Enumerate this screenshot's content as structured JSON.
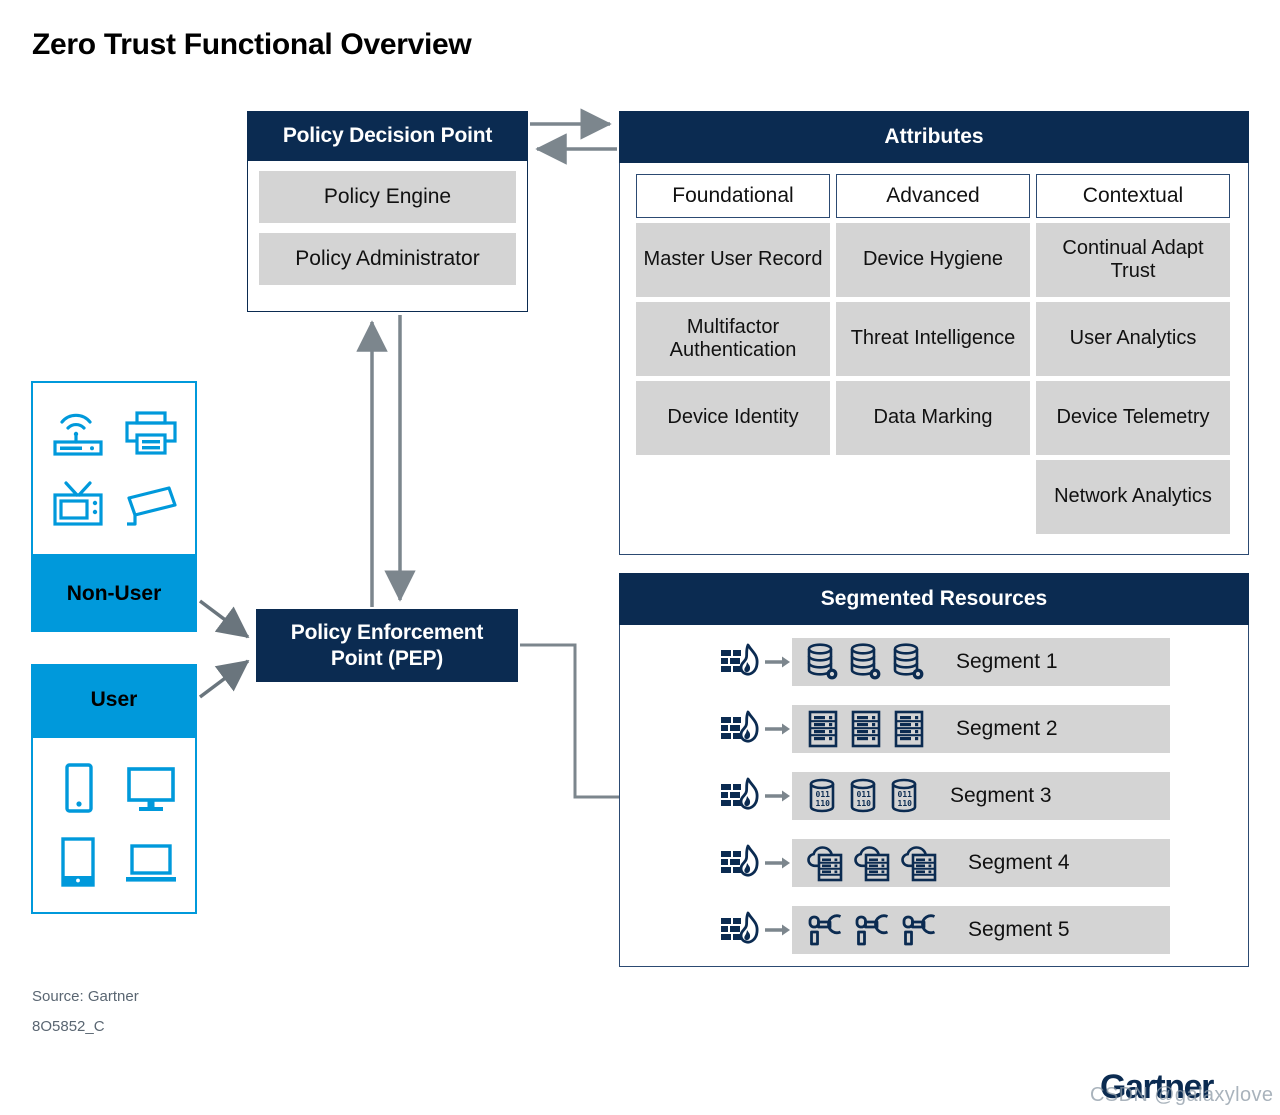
{
  "title": "Zero Trust Functional Overview",
  "colors": {
    "navy": "#0b2b51",
    "cyan": "#0099db",
    "grey_fill": "#d4d4d4",
    "connector_grey": "#7c868d",
    "border_blue": "#2c4a72"
  },
  "policy_decision_point": {
    "header": "Policy Decision Point",
    "items": [
      {
        "label": "Policy Engine"
      },
      {
        "label": "Policy Administrator"
      }
    ]
  },
  "attributes": {
    "header": "Attributes",
    "columns": [
      {
        "category": "Foundational",
        "items": [
          "Master User Record",
          "Multifactor Authentication",
          "Device Identity"
        ]
      },
      {
        "category": "Advanced",
        "items": [
          "Device Hygiene",
          "Threat Intelligence",
          "Data Marking"
        ]
      },
      {
        "category": "Contextual",
        "items": [
          "Continual Adapt Trust",
          "User Analytics",
          "Device Telemetry",
          "Network Analytics"
        ]
      }
    ]
  },
  "policy_enforcement_point": {
    "line1": "Policy Enforcement",
    "line2": "Point (PEP)"
  },
  "endpoints": [
    {
      "label": "Non-User",
      "icons": [
        "wifi-router-icon",
        "printer-icon",
        "television-icon",
        "security-camera-icon"
      ]
    },
    {
      "label": "User",
      "icons": [
        "smartphone-icon",
        "desktop-monitor-icon",
        "tablet-icon",
        "laptop-icon"
      ]
    }
  ],
  "segmented_resources": {
    "header": "Segmented Resources",
    "rows": [
      {
        "firewall_icon": "firewall-icon",
        "arrow_icon": "arrow-right-icon",
        "resource_icon": "database-gear-icon",
        "icon_count": 3,
        "label": "Segment 1"
      },
      {
        "firewall_icon": "firewall-icon",
        "arrow_icon": "arrow-right-icon",
        "resource_icon": "server-rack-icon",
        "icon_count": 3,
        "label": "Segment 2"
      },
      {
        "firewall_icon": "firewall-icon",
        "arrow_icon": "arrow-right-icon",
        "resource_icon": "data-cylinder-icon",
        "icon_count": 3,
        "label": "Segment 3"
      },
      {
        "firewall_icon": "firewall-icon",
        "arrow_icon": "arrow-right-icon",
        "resource_icon": "cloud-server-icon",
        "icon_count": 3,
        "label": "Segment 4"
      },
      {
        "firewall_icon": "firewall-icon",
        "arrow_icon": "arrow-right-icon",
        "resource_icon": "ot-robotic-arm-icon",
        "icon_count": 3,
        "label": "Segment 5"
      }
    ]
  },
  "footer": {
    "source": "Source: Gartner",
    "doc_id": "8O5852_C",
    "logo": "Gartner",
    "watermark": "CSDN @galaxylove"
  }
}
